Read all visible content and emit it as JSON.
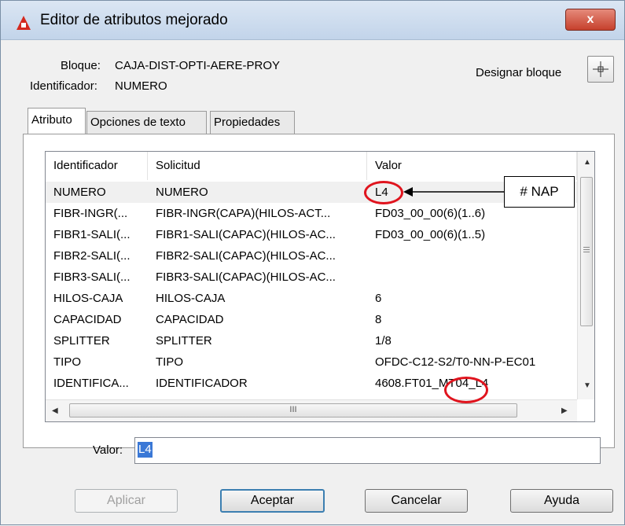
{
  "window": {
    "title": "Editor de atributos mejorado",
    "close_label": "x"
  },
  "block": {
    "bloque_label": "Bloque:",
    "bloque_value": "CAJA-DIST-OPTI-AERE-PROY",
    "ident_label": "Identificador:",
    "ident_value": "NUMERO",
    "designar_label": "Designar bloque"
  },
  "tabs": [
    {
      "label": "Atributo",
      "active": true
    },
    {
      "label": "Opciones de texto",
      "active": false
    },
    {
      "label": "Propiedades",
      "active": false
    }
  ],
  "grid": {
    "columns": [
      "Identificador",
      "Solicitud",
      "Valor"
    ],
    "rows": [
      [
        "NUMERO",
        "NUMERO",
        "L4"
      ],
      [
        "FIBR-INGR(...",
        "FIBR-INGR(CAPA)(HILOS-ACT...",
        "FD03_00_00(6)(1..6)"
      ],
      [
        "FIBR1-SALI(...",
        "FIBR1-SALI(CAPAC)(HILOS-AC...",
        "FD03_00_00(6)(1..5)"
      ],
      [
        "FIBR2-SALI(...",
        "FIBR2-SALI(CAPAC)(HILOS-AC...",
        ""
      ],
      [
        "FIBR3-SALI(...",
        "FIBR3-SALI(CAPAC)(HILOS-AC...",
        ""
      ],
      [
        "HILOS-CAJA",
        "HILOS-CAJA",
        "6"
      ],
      [
        "CAPACIDAD",
        "CAPACIDAD",
        "8"
      ],
      [
        "SPLITTER",
        "SPLITTER",
        "1/8"
      ],
      [
        "TIPO",
        "TIPO",
        "OFDC-C12-S2/T0-NN-P-EC01"
      ],
      [
        "IDENTIFICA...",
        "IDENTIFICADOR",
        "4608.FT01_MT04_L4"
      ]
    ],
    "selected_row": 0,
    "hscroll_grip": "III"
  },
  "annotation": {
    "label": "# NAP"
  },
  "valor": {
    "label": "Valor:",
    "value": "L4"
  },
  "buttons": {
    "aplicar": "Aplicar",
    "aceptar": "Aceptar",
    "cancelar": "Cancelar",
    "ayuda": "Ayuda"
  },
  "colors": {
    "highlight_ring": "#e0141e",
    "selection": "#3a78d6",
    "app_icon": "#d42a1f"
  }
}
